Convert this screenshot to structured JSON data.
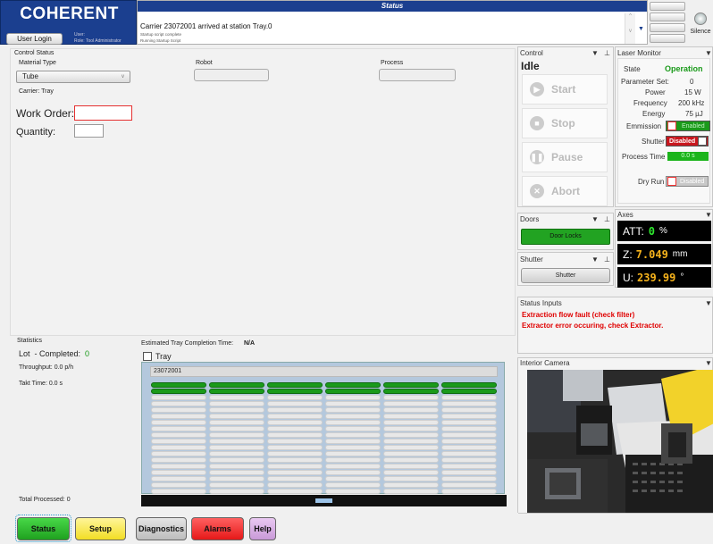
{
  "header": {
    "logo": "COHERENT",
    "user_login": "User Login",
    "user_label": "User:",
    "role_label": "Role: Tool Administrator",
    "status_title": "Status",
    "status_message": "Carrier 23072001 arrived at station Tray.0",
    "status_sub1": "Startup script complete",
    "status_sub2": "Running Startup Script",
    "silence_label": "Silence"
  },
  "control_status": {
    "title": "Control Status",
    "material_type_label": "Material Type",
    "material_type_value": "Tube",
    "carrier_label": "Carrier: Tray",
    "work_order_label": "Work Order:",
    "work_order_value": "",
    "quantity_label": "Quantity:",
    "quantity_value": "",
    "robot_label": "Robot",
    "process_label": "Process"
  },
  "statistics": {
    "title": "Statistics",
    "lot_label": "Lot  - Completed:",
    "lot_value": "0",
    "throughput": "Throughput: 0.0 p/h",
    "takt": "Takt Time: 0.0 s",
    "total": "Total Processed: 0"
  },
  "tray": {
    "completion_label": "Estimated Tray Completion Time:",
    "completion_value": "N/A",
    "checkbox_label": "Tray",
    "carrier_id": "23072001",
    "green_rows": 2,
    "grey_rows": 16,
    "columns": 6
  },
  "control": {
    "title": "Control",
    "state": "Idle",
    "start": "Start",
    "stop": "Stop",
    "pause": "Pause",
    "abort": "Abort"
  },
  "laser_monitor": {
    "title": "Laser Monitor",
    "state_label": "State",
    "state_value": "Operation",
    "param_label": "Parameter Set:",
    "param_value": "0",
    "power_label": "Power",
    "power_value": "15 W",
    "freq_label": "Frequency",
    "freq_value": "200 kHz",
    "energy_label": "Energy",
    "energy_value": "75 µJ",
    "emission_label": "Emmission",
    "emission_value": "Enabled",
    "shutter_label": "Shutter",
    "shutter_value": "Disabled",
    "process_time_label": "Process Time",
    "process_time_value": "0.0 s",
    "dry_run_label": "Dry Run",
    "dry_run_value": "Disabled"
  },
  "doors": {
    "title": "Doors",
    "button": "Door Locks"
  },
  "shutter_panel": {
    "title": "Shutter",
    "button": "Shutter"
  },
  "axes": {
    "title": "Axes",
    "att_label": "ATT:",
    "att_value": "0",
    "att_unit": "%",
    "z_label": "Z:",
    "z_value": "7.049",
    "z_unit": "mm",
    "u_label": "U:",
    "u_value": "239.99",
    "u_unit": "°"
  },
  "status_inputs": {
    "title": "Status Inputs",
    "line1": "Extraction flow fault (check filter)",
    "line2": "Extractor error occuring, check Extractor."
  },
  "camera": {
    "title": "Interior Camera"
  },
  "nav": {
    "status": "Status",
    "setup": "Setup",
    "diagnostics": "Diagnostics",
    "alarms": "Alarms",
    "help": "Help"
  },
  "colors": {
    "logo_bg": "#1b3f8f",
    "green": "#1a9a1a",
    "red_text": "#e00000",
    "disabled_red": "#c8161d"
  }
}
